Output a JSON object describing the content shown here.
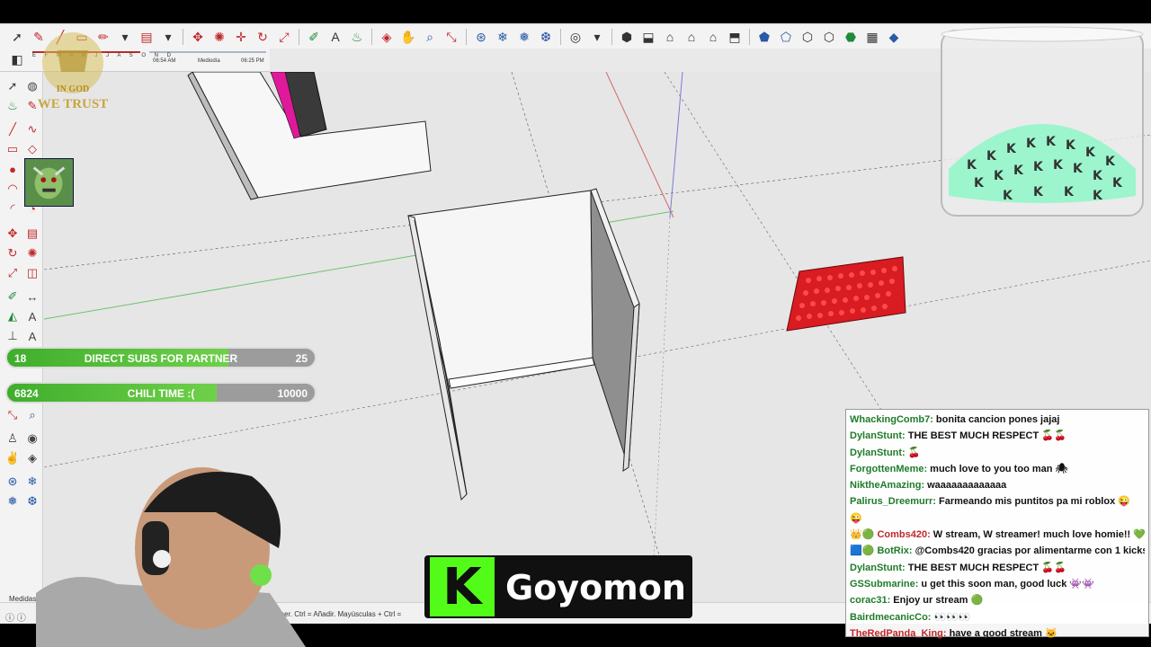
{
  "toolbar2": {
    "measure_label": "Medidas"
  },
  "shadow": {
    "months": "E F M A M J J A S O N D",
    "time_start": "06:54 AM",
    "time_mid": "Mediodía",
    "time_end": "06:25 PM"
  },
  "status": {
    "measure_label": "Medidas",
    "hint": "s = Añadir/Sustraer. Ctrl = Añadir. Mayúsculas + Ctrl ="
  },
  "goals": [
    {
      "current": "18",
      "title": "DIRECT SUBS FOR PARTNER",
      "target": "25",
      "progress": 0.72
    },
    {
      "current": "6824",
      "title": "CHILI TIME :(",
      "target": "10000",
      "progress": 0.68
    }
  ],
  "logo": {
    "line1": "IN GOD",
    "line2": "WE TRUST"
  },
  "banner": {
    "k": "K",
    "name": "Goyomon"
  },
  "chat": [
    {
      "user": "WhackingComb7:",
      "color": "#1e7c2a",
      "message": "bonita cancion pones jajaj"
    },
    {
      "user": "DylanStunt:",
      "color": "#1e7c2a",
      "message": "THE BEST MUCH RESPECT 🍒🍒"
    },
    {
      "user": "DylanStunt:",
      "color": "#1e7c2a",
      "message": "🍒"
    },
    {
      "user": "ForgottenMeme:",
      "color": "#1e7c2a",
      "message": "much love to you too man 🕷"
    },
    {
      "user": "NiktheAmazing:",
      "color": "#1e7c2a",
      "message": "waaaaaaaaaaaaa"
    },
    {
      "user": "Palirus_Dreemurr:",
      "color": "#1e7c2a",
      "message": "Farmeando mis puntitos pa mi roblox 😜"
    },
    {
      "user": "😜",
      "color": "#111111",
      "message": ""
    },
    {
      "user": "👑🟢 Combs420:",
      "color": "#c0282a",
      "message": "W stream, W streamer! much love homie!! 💚"
    },
    {
      "user": "🟦🟢 BotRix:",
      "color": "#1e7c2a",
      "message": "@Combs420 gracias por alimentarme con 1 kicks!"
    },
    {
      "user": "DylanStunt:",
      "color": "#1e7c2a",
      "message": "THE BEST MUCH RESPECT 🍒🍒"
    },
    {
      "user": "GSSubmarine:",
      "color": "#1e7c2a",
      "message": "u get this soon man, good luck 👾👾"
    },
    {
      "user": "corac31:",
      "color": "#1e7c2a",
      "message": "Enjoy ur stream 🟢"
    },
    {
      "user": "BairdmecanicCo:",
      "color": "#1e7c2a",
      "message": "👀👀👀"
    },
    {
      "user": "TheRedPanda_King:",
      "color": "#c0282a",
      "message": "have a good stream 🐱"
    }
  ]
}
